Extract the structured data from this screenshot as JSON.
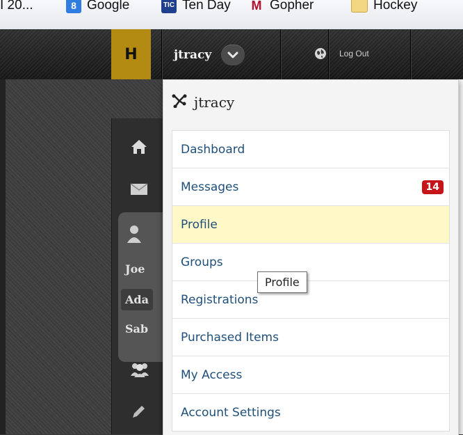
{
  "bookmarks": [
    {
      "label": "I 20...",
      "icon": "none"
    },
    {
      "label": "Google",
      "icon": "google-icon"
    },
    {
      "label": "Ten Day",
      "icon": "ten-day-icon"
    },
    {
      "label": "Gopher",
      "icon": "gopher-icon"
    },
    {
      "label": "Hockey",
      "icon": "folder-icon"
    }
  ],
  "header": {
    "logo_letter": "H",
    "username": "jtracy",
    "logout_label": "Log Out"
  },
  "sidebar": {
    "sub_items": [
      "Joe",
      "Ada",
      "Sab"
    ]
  },
  "dropdown": {
    "title": "jtracy",
    "items": [
      {
        "label": "Dashboard"
      },
      {
        "label": "Messages",
        "badge": "14"
      },
      {
        "label": "Profile"
      },
      {
        "label": "Groups"
      },
      {
        "label": "Registrations"
      },
      {
        "label": "Purchased Items"
      },
      {
        "label": "My Access"
      },
      {
        "label": "Account Settings"
      }
    ]
  },
  "tooltip": {
    "text": "Profile"
  },
  "colors": {
    "accent_gold": "#b38b12",
    "link_blue": "#1f4f7a",
    "badge_red": "#c6141a",
    "hover_yellow": "#fff9c8"
  }
}
